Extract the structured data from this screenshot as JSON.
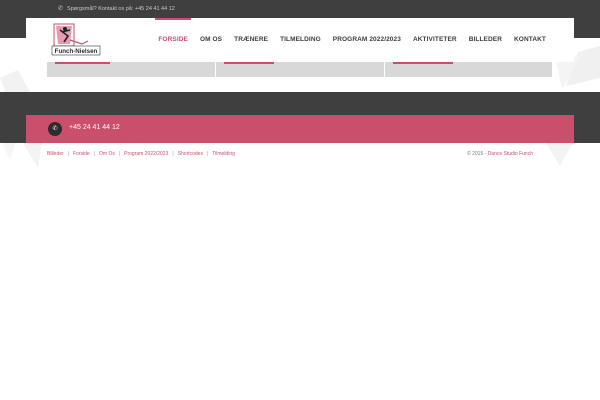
{
  "topbar": {
    "contact_text": "Spørgsmål? Kontakt os på: +45 24 41 44 12",
    "phone_icon": "phone-icon"
  },
  "logo": {
    "line1": "Funch-Nielsen"
  },
  "nav": {
    "items": [
      {
        "label": "FORSIDE",
        "active": true
      },
      {
        "label": "OM OS",
        "active": false
      },
      {
        "label": "TRÆNERE",
        "active": false
      },
      {
        "label": "TILMELDING",
        "active": false
      },
      {
        "label": "PROGRAM 2022/2023",
        "active": false
      },
      {
        "label": "AKTIVITETER",
        "active": false
      },
      {
        "label": "BILLEDER",
        "active": false
      },
      {
        "label": "KONTAKT",
        "active": false
      }
    ]
  },
  "contact_bar": {
    "phone": "+45 24 41 44 12",
    "icon": "phone-icon"
  },
  "footer": {
    "links": [
      "Billeder",
      "Forside",
      "Om Os",
      "Program 2022/2023",
      "Shortcodes",
      "Tilmelding"
    ],
    "copyright_prefix": "© 2015 - ",
    "copyright_brand": "Dance Studio Funch"
  },
  "colors": {
    "accent": "#c94f6d",
    "dark": "#3f3f3f",
    "card": "#d8d8d8"
  }
}
